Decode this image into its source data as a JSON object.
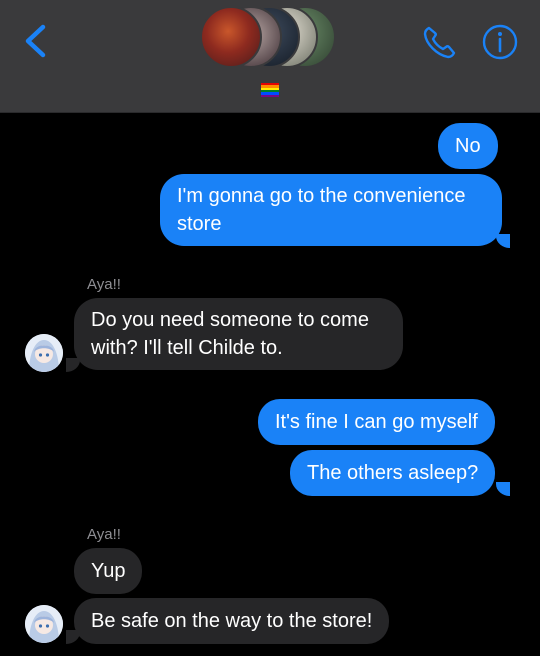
{
  "header": {
    "back_icon": "chevron-left-icon",
    "group_avatar_count": 5,
    "status_emoji": "rainbow-flag",
    "call_icon": "phone-icon",
    "info_icon": "info-icon",
    "accent_color": "#1a82f7"
  },
  "messages": [
    {
      "direction": "outgoing",
      "text": "No"
    },
    {
      "direction": "outgoing",
      "text": "I'm gonna go to the convenience store"
    },
    {
      "direction": "incoming",
      "sender": "Aya!!",
      "text": "Do you need someone to come with? I'll tell Childe to."
    },
    {
      "direction": "outgoing",
      "text": "It's fine I can go myself"
    },
    {
      "direction": "outgoing",
      "text": "The others asleep?"
    },
    {
      "direction": "incoming",
      "sender": "Aya!!",
      "text": "Yup"
    },
    {
      "direction": "incoming",
      "text": "Be safe on the way to the store!"
    }
  ]
}
